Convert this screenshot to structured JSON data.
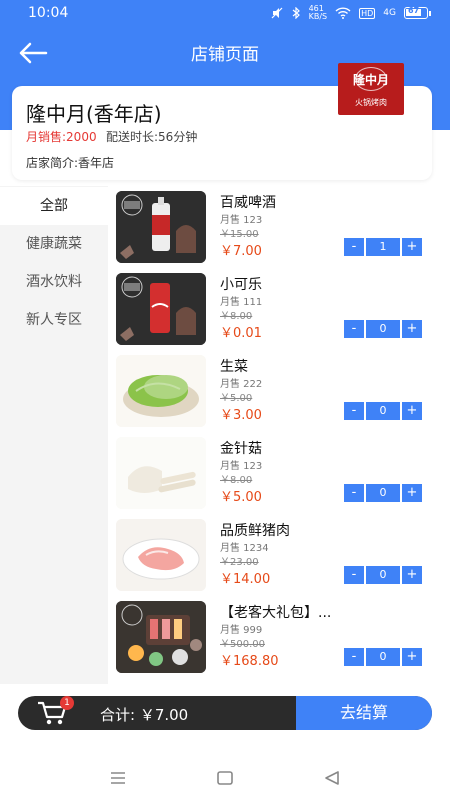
{
  "status_bar": {
    "time": "10:04",
    "net_speed": "461\nKB/S",
    "hd": "HD",
    "signal": "4G",
    "battery": "67"
  },
  "header": {
    "title": "店铺页面",
    "back_icon": "arrow-left-icon"
  },
  "store": {
    "name": "隆中月(香年店)",
    "monthly_sales": "月销售:2000",
    "delivery_time": "配送时长:56分钟",
    "intro": "店家简介:香年店",
    "logo_main": "隆中月",
    "logo_sub": "火锅烤肉"
  },
  "sidebar": {
    "items": [
      {
        "label": "全部",
        "active": true
      },
      {
        "label": "健康蔬菜",
        "active": false
      },
      {
        "label": "酒水饮料",
        "active": false
      },
      {
        "label": "新人专区",
        "active": false
      }
    ]
  },
  "products": [
    {
      "name": "百威啤酒",
      "sold": "月售 123",
      "original": "￥15.00",
      "price": "￥7.00",
      "qty": "1",
      "thumb": "beer-image"
    },
    {
      "name": "小可乐",
      "sold": "月售 111",
      "original": "￥8.00",
      "price": "￥0.01",
      "qty": "0",
      "thumb": "cola-image"
    },
    {
      "name": "生菜",
      "sold": "月售 222",
      "original": "￥5.00",
      "price": "￥3.00",
      "qty": "0",
      "thumb": "lettuce-image"
    },
    {
      "name": "金针菇",
      "sold": "月售 123",
      "original": "￥8.00",
      "price": "￥5.00",
      "qty": "0",
      "thumb": "enoki-image"
    },
    {
      "name": "品质鲜猪肉",
      "sold": "月售 1234",
      "original": "￥23.00",
      "price": "￥14.00",
      "qty": "0",
      "thumb": "pork-image"
    },
    {
      "name": "【老客大礼包】...",
      "sold": "月售 999",
      "original": "￥500.00",
      "price": "￥168.80",
      "qty": "0",
      "thumb": "bbq-platter-image"
    }
  ],
  "stepper": {
    "minus": "-",
    "plus": "+"
  },
  "cart": {
    "badge": "1",
    "total": "合计: ￥7.00",
    "checkout_label": "去结算"
  },
  "colors": {
    "primary": "#3f82f7",
    "price_red": "#e64a19",
    "sales_red": "#e53935",
    "cart_dark": "#2b2b2b"
  }
}
